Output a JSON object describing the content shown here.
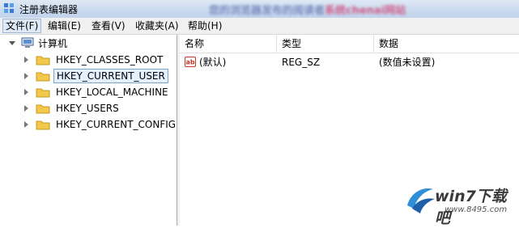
{
  "window": {
    "title": "注册表编辑器",
    "blurred_banner": "您的浏览器发布的阅读者",
    "blurred_banner_red": "系统chenai网站"
  },
  "menu": [
    {
      "label": "文件(F)",
      "active": true
    },
    {
      "label": "编辑(E)"
    },
    {
      "label": "查看(V)"
    },
    {
      "label": "收藏夹(A)"
    },
    {
      "label": "帮助(H)"
    }
  ],
  "tree": {
    "root": {
      "label": "计算机",
      "icon": "computer-icon"
    },
    "items": [
      {
        "label": "HKEY_CLASSES_ROOT"
      },
      {
        "label": "HKEY_CURRENT_USER",
        "selected": true
      },
      {
        "label": "HKEY_LOCAL_MACHINE"
      },
      {
        "label": "HKEY_USERS"
      },
      {
        "label": "HKEY_CURRENT_CONFIG"
      }
    ]
  },
  "list": {
    "columns": [
      "名称",
      "类型",
      "数据"
    ],
    "rows": [
      {
        "name": "(默认)",
        "type": "REG_SZ",
        "data": "(数值未设置)",
        "icon": "string-value-icon"
      }
    ]
  },
  "watermark": {
    "brand": "win7下载吧",
    "url": "www.8495.com"
  },
  "colors": {
    "titlebar": "#c9d9ee",
    "selection_border": "#7da2ce",
    "selection_fill": "#e4efff",
    "folder_yellow": "#f2c84b"
  }
}
